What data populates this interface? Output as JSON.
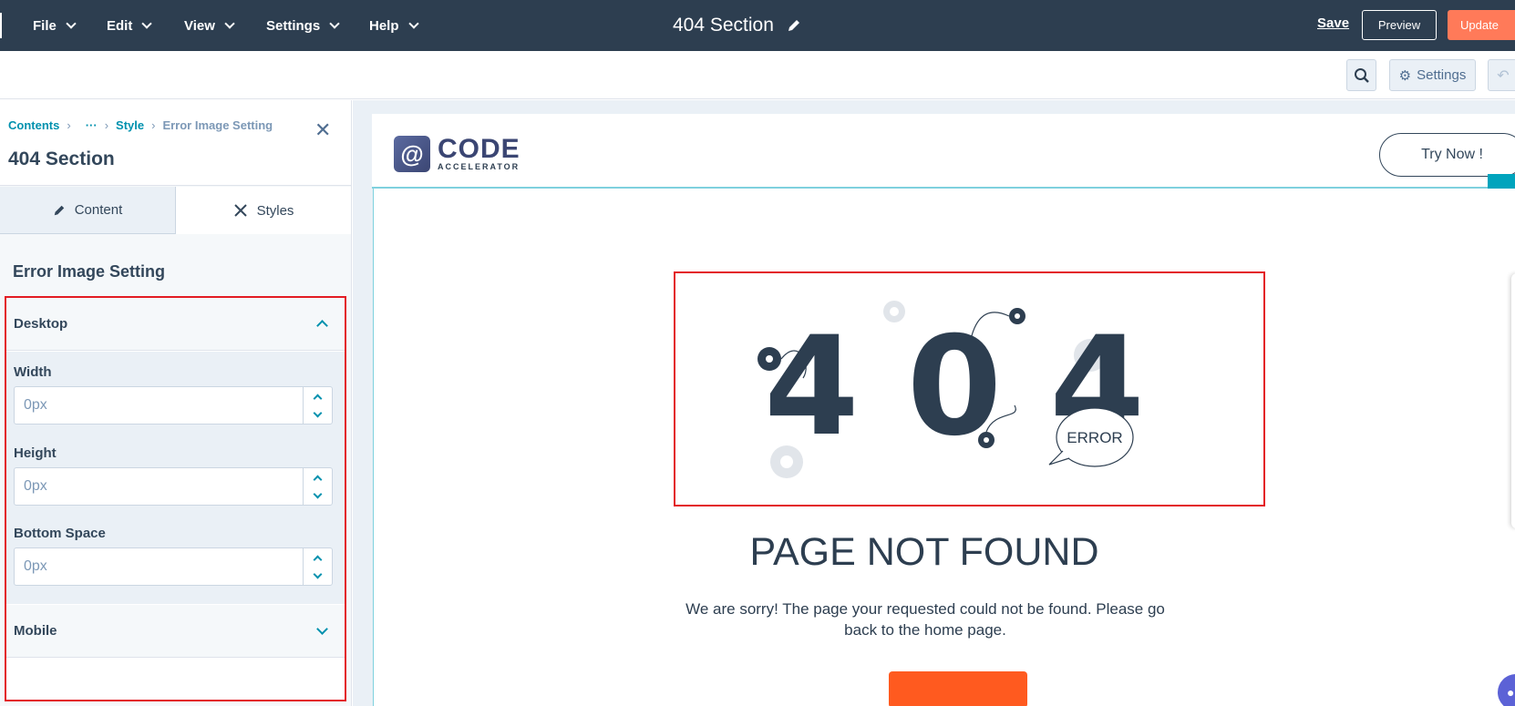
{
  "topbar": {
    "menus": [
      {
        "label": "File"
      },
      {
        "label": "Edit"
      },
      {
        "label": "View"
      },
      {
        "label": "Settings"
      },
      {
        "label": "Help"
      }
    ],
    "doc_title": "404 Section",
    "save_label": "Save",
    "preview_label": "Preview",
    "update_label": "Update"
  },
  "toolbar": {
    "settings_label": "Settings"
  },
  "sidebar": {
    "breadcrumb": [
      "Contents",
      "···",
      "Style",
      "Error Image Setting"
    ],
    "title": "404 Section",
    "tabs": [
      {
        "label": "Content"
      },
      {
        "label": "Styles"
      }
    ],
    "section_title": "Error Image Setting",
    "desktop_label": "Desktop",
    "mobile_label": "Mobile",
    "fields": [
      {
        "label": "Width",
        "placeholder": "0px"
      },
      {
        "label": "Height",
        "placeholder": "0px"
      },
      {
        "label": "Bottom Space",
        "placeholder": "0px"
      }
    ]
  },
  "preview": {
    "logo_main": "CODE",
    "logo_sub": "ACCELERATOR",
    "cta_label": "Try Now !",
    "error_digits": "4 0 4",
    "error_bubble": "ERROR",
    "heading": "PAGE NOT FOUND",
    "message": "We are sorry! The page your requested could not be found. Please go back to the home page."
  },
  "colors": {
    "topbar": "#2d3e50",
    "accent": "#0091ae",
    "update": "#ff7a59",
    "highlight": "#e31b23",
    "home_button": "#ff5a1f"
  }
}
